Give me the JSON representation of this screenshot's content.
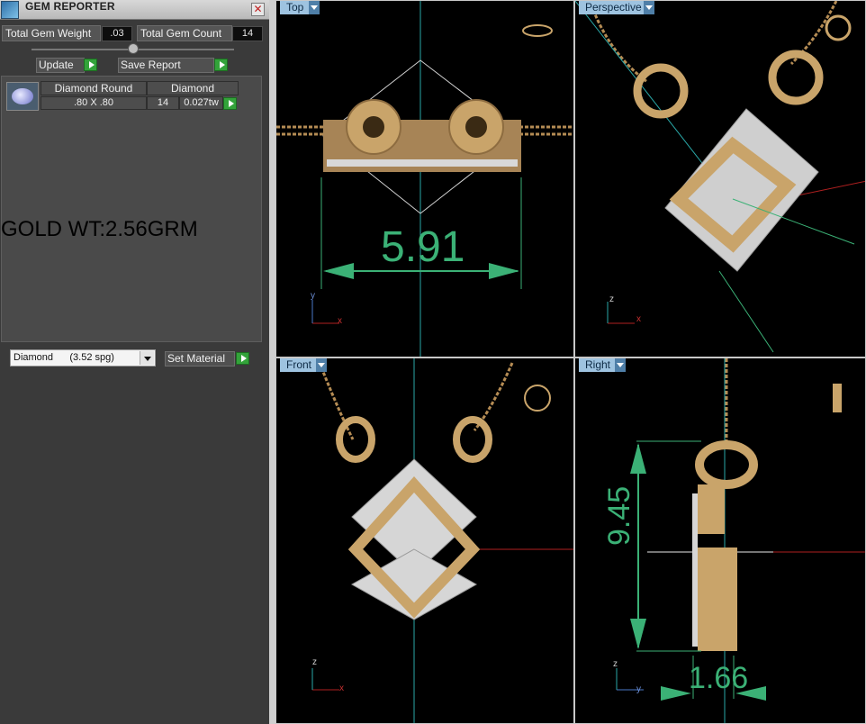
{
  "window": {
    "title": "GEM REPORTER",
    "close": "✕"
  },
  "summary": {
    "total_gem_weight_label": "Total Gem Weight",
    "total_gem_weight_value": ".03",
    "total_gem_count_label": "Total Gem Count",
    "total_gem_count_value": "14"
  },
  "buttons": {
    "update": "Update",
    "save_report": "Save Report",
    "set_material": "Set Material"
  },
  "gem_table": {
    "headers": [
      "Diamond Round",
      "Diamond"
    ],
    "row": {
      "size": ".80 X .80",
      "count": "14",
      "weight": "0.027tw"
    }
  },
  "note": "GOLD WT:2.56GRM",
  "material": {
    "selected": "Diamond      (3.52 spg)"
  },
  "viewports": {
    "top": {
      "label": "Top",
      "dimension": "5.91"
    },
    "persp": {
      "label": "Perspective"
    },
    "front": {
      "label": "Front"
    },
    "right": {
      "label": "Right",
      "dimension_height": "9.45",
      "dimension_width": "1.66"
    }
  },
  "axes": {
    "x": "x",
    "y": "y",
    "z": "z"
  },
  "colors": {
    "dimension": "#3bb176",
    "gold": "#c9a46a",
    "tab": "#9ec3e0",
    "go_button": "#33a33a"
  }
}
